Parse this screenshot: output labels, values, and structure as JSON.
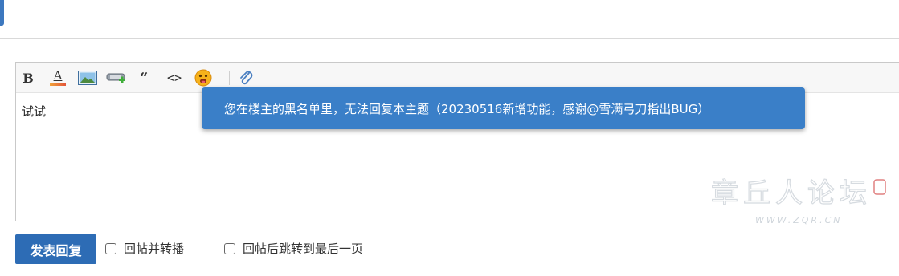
{
  "editor": {
    "content": "试试",
    "toolbar": {
      "bold_label": "B",
      "font_color_label": "A",
      "quote_label": "“",
      "code_label": "<>",
      "icons": [
        "bold-icon",
        "font-color-icon",
        "image-icon",
        "link-icon",
        "quote-icon",
        "code-icon",
        "emoji-icon",
        "attachment-icon"
      ]
    }
  },
  "toast": {
    "message": "您在楼主的黑名单里，无法回复本主题（20230516新增功能，感谢@雪满弓刀指出BUG）",
    "color": "#3a7fc8"
  },
  "watermark": {
    "title": "章丘人论坛",
    "url": "WWW.ZQR.CN"
  },
  "actions": {
    "submit_label": "发表回复",
    "submit_color": "#2d6cb5",
    "option1_label": "回帖并转播",
    "option2_label": "回帖后跳转到最后一页"
  }
}
